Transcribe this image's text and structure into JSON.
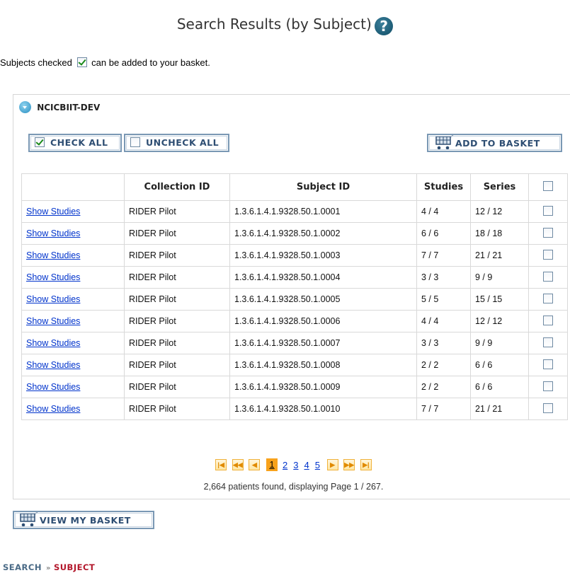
{
  "page": {
    "title": "Search Results (by Subject)",
    "help_glyph": "?",
    "note_before": "Subjects checked",
    "note_after": "can be added to your basket."
  },
  "panel": {
    "header": "NCICBIIT-DEV"
  },
  "toolbar": {
    "check_all": "CHECK ALL",
    "uncheck_all": "UNCHECK ALL",
    "add_to_basket": "ADD TO BASKET"
  },
  "table": {
    "headers": [
      "",
      "Collection ID",
      "Subject ID",
      "Studies",
      "Series"
    ],
    "rows": [
      {
        "link": "Show Studies",
        "collection": "RIDER Pilot",
        "subject": "1.3.6.1.4.1.9328.50.1.0001",
        "studies": "4 / 4",
        "series": "12 / 12"
      },
      {
        "link": "Show Studies",
        "collection": "RIDER Pilot",
        "subject": "1.3.6.1.4.1.9328.50.1.0002",
        "studies": "6 / 6",
        "series": "18 / 18"
      },
      {
        "link": "Show Studies",
        "collection": "RIDER Pilot",
        "subject": "1.3.6.1.4.1.9328.50.1.0003",
        "studies": "7 / 7",
        "series": "21 / 21"
      },
      {
        "link": "Show Studies",
        "collection": "RIDER Pilot",
        "subject": "1.3.6.1.4.1.9328.50.1.0004",
        "studies": "3 / 3",
        "series": "9 / 9"
      },
      {
        "link": "Show Studies",
        "collection": "RIDER Pilot",
        "subject": "1.3.6.1.4.1.9328.50.1.0005",
        "studies": "5 / 5",
        "series": "15 / 15"
      },
      {
        "link": "Show Studies",
        "collection": "RIDER Pilot",
        "subject": "1.3.6.1.4.1.9328.50.1.0006",
        "studies": "4 / 4",
        "series": "12 / 12"
      },
      {
        "link": "Show Studies",
        "collection": "RIDER Pilot",
        "subject": "1.3.6.1.4.1.9328.50.1.0007",
        "studies": "3 / 3",
        "series": "9 / 9"
      },
      {
        "link": "Show Studies",
        "collection": "RIDER Pilot",
        "subject": "1.3.6.1.4.1.9328.50.1.0008",
        "studies": "2 / 2",
        "series": "6 / 6"
      },
      {
        "link": "Show Studies",
        "collection": "RIDER Pilot",
        "subject": "1.3.6.1.4.1.9328.50.1.0009",
        "studies": "2 / 2",
        "series": "6 / 6"
      },
      {
        "link": "Show Studies",
        "collection": "RIDER Pilot",
        "subject": "1.3.6.1.4.1.9328.50.1.0010",
        "studies": "7 / 7",
        "series": "21 / 21"
      }
    ]
  },
  "pager": {
    "pages": [
      "1",
      "2",
      "3",
      "4",
      "5"
    ],
    "current": "1",
    "info": "2,664 patients found, displaying Page 1 / 267."
  },
  "footer": {
    "view_basket": "VIEW MY BASKET",
    "breadcrumb": [
      "SEARCH",
      "SUBJECT"
    ],
    "breadcrumb_sep": "»"
  },
  "colors": {
    "link": "#0033cc",
    "button_border": "#7a98b4",
    "button_text": "#2e4e73",
    "pager_current": "#f8a21b",
    "breadcrumb_active": "#b3172b"
  }
}
